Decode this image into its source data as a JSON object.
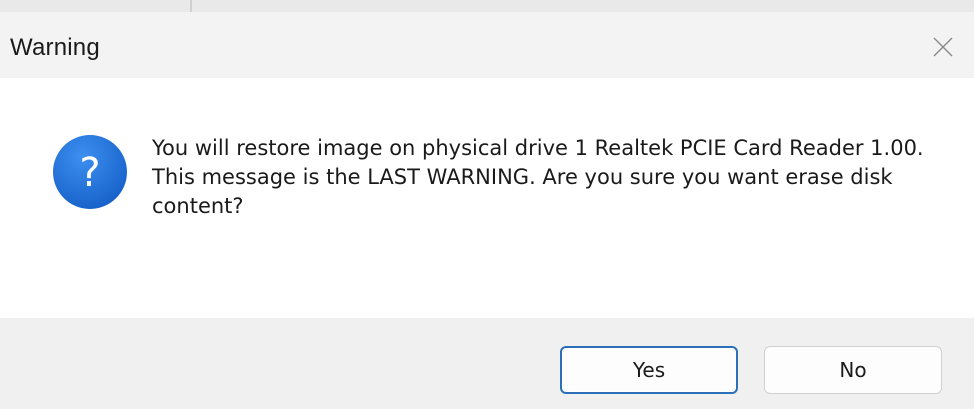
{
  "window": {
    "title": "Warning"
  },
  "icons": {
    "close": "close-icon",
    "question": "question-icon"
  },
  "colors": {
    "icon_blue": "#1e6fd6",
    "default_button_border": "#2a6fb8"
  },
  "message": {
    "line1": "You will restore image on physical drive 1 Realtek PCIE Card Reader 1.00.",
    "line2": "This message is the LAST WARNING. Are you sure you want erase disk content?"
  },
  "buttons": {
    "yes_label": "Yes",
    "no_label": "No"
  }
}
